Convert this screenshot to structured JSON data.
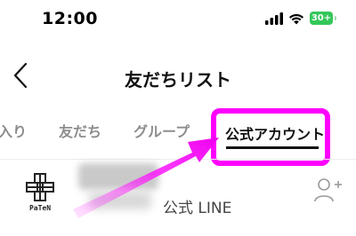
{
  "status_bar": {
    "time": "12:00",
    "battery_level": "30+",
    "battery_color": "#34c759"
  },
  "header": {
    "title": "友だちリスト",
    "back_icon": "chevron-left-icon"
  },
  "tabs": [
    {
      "label": "入り",
      "active": false
    },
    {
      "label": "友だち",
      "active": false
    },
    {
      "label": "グループ",
      "active": false
    },
    {
      "label": "公式アカウント",
      "active": true
    }
  ],
  "highlight_color": "#ff00ff",
  "list": {
    "items": [
      {
        "logo_text": "PaTeN",
        "subtitle": "公式 LINE",
        "action_icon": "add-friend-icon"
      }
    ]
  }
}
